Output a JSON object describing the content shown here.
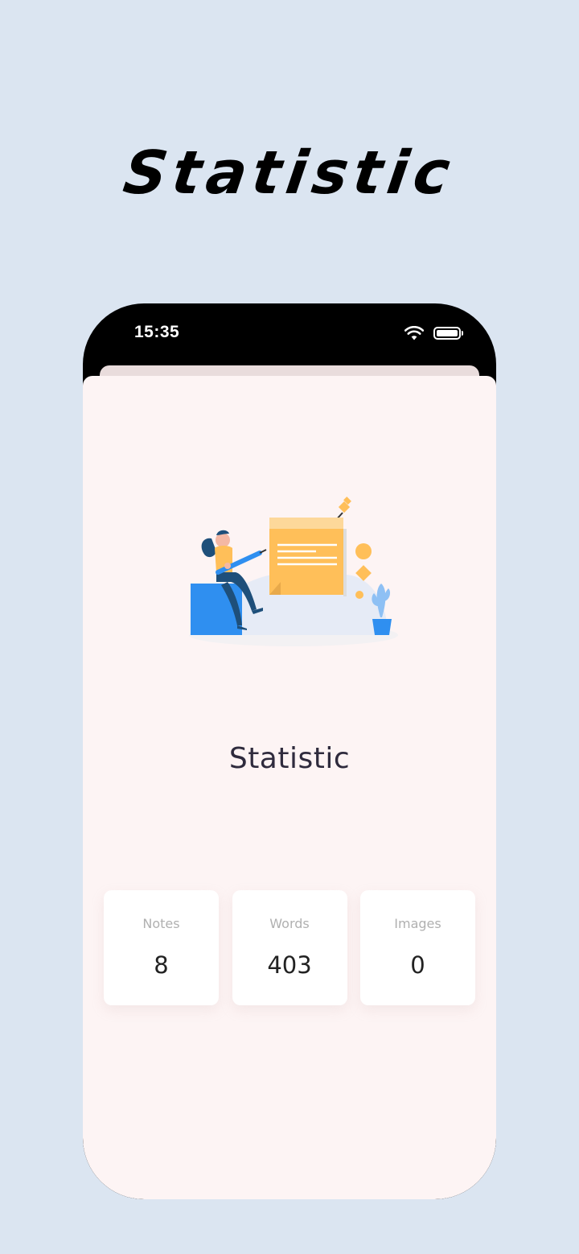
{
  "hero": {
    "title": "Statistic"
  },
  "status_bar": {
    "time": "15:35",
    "icons": [
      "wifi-icon",
      "battery-icon"
    ]
  },
  "page": {
    "title": "Statistic",
    "illustration": "note-writing-illustration"
  },
  "stats": [
    {
      "label": "Notes",
      "value": "8"
    },
    {
      "label": "Words",
      "value": "403"
    },
    {
      "label": "Images",
      "value": "0"
    }
  ],
  "colors": {
    "background": "#dbe5f1",
    "sheet": "#fdf4f4",
    "accent_blue": "#2f8ff0",
    "accent_yellow": "#ffbf59"
  }
}
